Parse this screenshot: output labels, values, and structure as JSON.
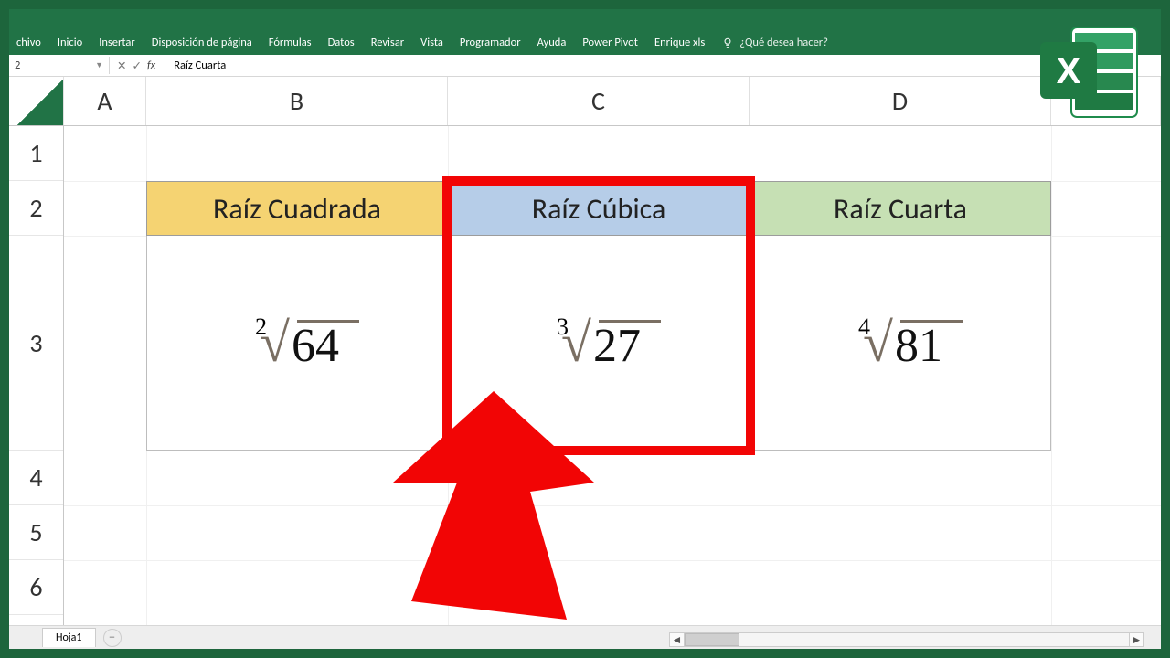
{
  "ribbon": {
    "tabs": [
      "chivo",
      "Inicio",
      "Insertar",
      "Disposición de página",
      "Fórmulas",
      "Datos",
      "Revisar",
      "Vista",
      "Programador",
      "Ayuda",
      "Power Pivot",
      "Enrique xls"
    ],
    "tell_me": "¿Qué desea hacer?"
  },
  "formula_bar": {
    "name_box": "2",
    "cancel": "✕",
    "enter": "✓",
    "fx": "fx",
    "value": "Raíz Cuarta"
  },
  "columns": [
    "A",
    "B",
    "C",
    "D"
  ],
  "rows": [
    "1",
    "2",
    "3",
    "4",
    "5",
    "6"
  ],
  "headers": {
    "b": "Raíz Cuadrada",
    "c": "Raíz Cúbica",
    "d": "Raíz Cuarta"
  },
  "roots": {
    "b": {
      "degree": "2",
      "radicand": "64"
    },
    "c": {
      "degree": "3",
      "radicand": "27"
    },
    "d": {
      "degree": "4",
      "radicand": "81"
    }
  },
  "sheet": {
    "tab": "Hoja1",
    "add": "+"
  },
  "logo_letter": "X"
}
